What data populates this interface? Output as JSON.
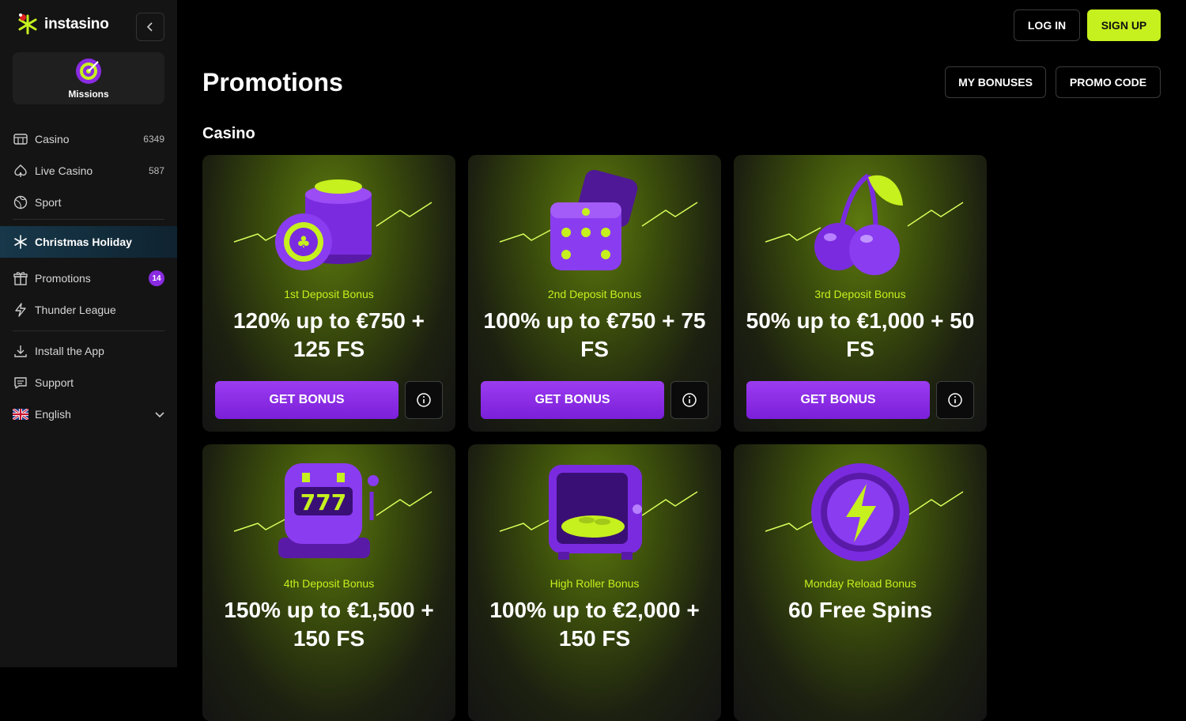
{
  "brand": {
    "name": "instasino"
  },
  "missions": {
    "label": "Missions"
  },
  "nav": {
    "casino": {
      "label": "Casino",
      "count": "6349"
    },
    "live_casino": {
      "label": "Live Casino",
      "count": "587"
    },
    "sport": {
      "label": "Sport"
    },
    "christmas": {
      "label": "Christmas Holiday"
    },
    "promotions": {
      "label": "Promotions",
      "badge": "14"
    },
    "thunder": {
      "label": "Thunder League"
    },
    "install": {
      "label": "Install the App"
    },
    "support": {
      "label": "Support"
    },
    "language": {
      "label": "English"
    }
  },
  "header": {
    "login": "LOG IN",
    "signup": "SIGN UP"
  },
  "page": {
    "title": "Promotions",
    "my_bonuses": "MY BONUSES",
    "promo_code": "PROMO CODE",
    "section": "Casino"
  },
  "cards": [
    {
      "subtitle": "1st Deposit Bonus",
      "headline": "120% up to €750 + 125 FS",
      "cta": "GET BONUS",
      "icon": "casino-chips-icon"
    },
    {
      "subtitle": "2nd Deposit Bonus",
      "headline": "100% up to €750 + 75 FS",
      "cta": "GET BONUS",
      "icon": "dice-icon"
    },
    {
      "subtitle": "3rd Deposit Bonus",
      "headline": "50% up to €1,000 + 50 FS",
      "cta": "GET BONUS",
      "icon": "cherries-icon"
    },
    {
      "subtitle": "4th Deposit Bonus",
      "headline": "150% up to €1,500 + 150 FS",
      "icon": "slot-machine-icon"
    },
    {
      "subtitle": "High Roller Bonus",
      "headline": "100% up to €2,000 + 150 FS",
      "icon": "safe-icon"
    },
    {
      "subtitle": "Monday Reload Bonus",
      "headline": "60 Free Spins",
      "icon": "lightning-coin-icon"
    }
  ],
  "colors": {
    "accent_lime": "#c6f01e",
    "accent_purple": "#8a2be2",
    "background": "#000000",
    "sidebar": "#141414"
  }
}
